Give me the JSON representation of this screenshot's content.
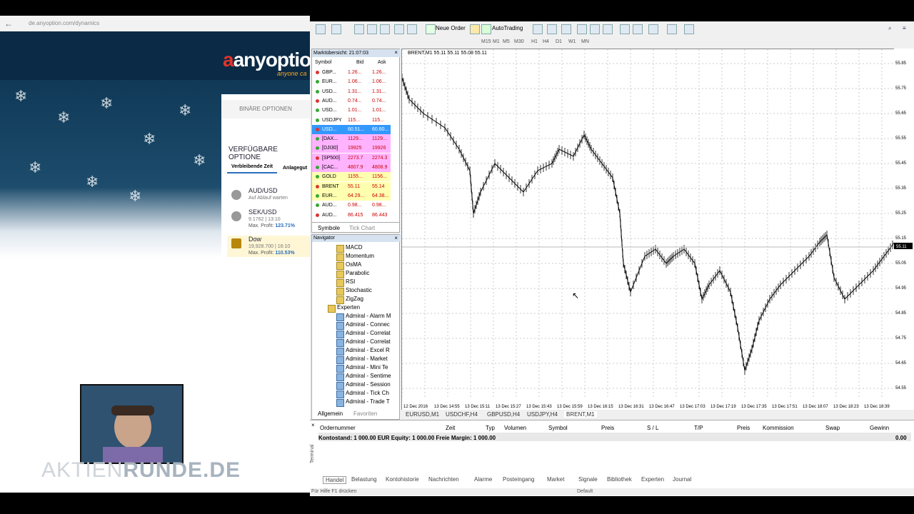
{
  "browser": {
    "url": "de.anyoption.com/dynamics",
    "logo": "anyoptio",
    "tagline": "anyone ca",
    "binaere_label": "BINÄRE OPTIONEN",
    "verfuegbare_label": "VERFÜGBARE OPTIONE",
    "tab_verbleibende": "Verbleibende Zeit",
    "tab_anlage": "Anlagegut",
    "assets": [
      {
        "name": "AUD/USD",
        "sub": "Auf Ablauf warten",
        "profit_label": "",
        "profit": ""
      },
      {
        "name": "SEK/USD",
        "sub": "9.1762 | 13:10",
        "profit_label": "Max. Profit:",
        "profit": "123.71%"
      },
      {
        "name": "Dow",
        "sub": "19,928.700 | 16:10",
        "profit_label": "Max. Profit:",
        "profit": "110.53%"
      }
    ],
    "watermark_left": "AKTIEN",
    "watermark_right": "RUNDE.DE"
  },
  "toolbar": {
    "new_order": "Neue Order",
    "autotrading": "AutoTrading",
    "timeframes": [
      "M1",
      "M5",
      "M15",
      "M30",
      "H1",
      "H4",
      "D1",
      "W1",
      "MN"
    ]
  },
  "market_watch": {
    "title": "Marktübersicht: 21:07:03",
    "col_symbol": "Symbol",
    "col_bid": "Bid",
    "col_ask": "Ask",
    "rows": [
      {
        "symbol": "GBP...",
        "bid": "1.26...",
        "ask": "1.26..."
      },
      {
        "symbol": "EUR...",
        "bid": "1.06...",
        "ask": "1.06..."
      },
      {
        "symbol": "USD...",
        "bid": "1.31...",
        "ask": "1.31..."
      },
      {
        "symbol": "AUD...",
        "bid": "0.74...",
        "ask": "0.74..."
      },
      {
        "symbol": "USD...",
        "bid": "1.01...",
        "ask": "1.01..."
      },
      {
        "symbol": "USDJPY",
        "bid": "115...",
        "ask": "115..."
      },
      {
        "symbol": "USD...",
        "bid": "60.51...",
        "ask": "60.60..."
      },
      {
        "symbol": "[DAX...",
        "bid": "1129...",
        "ask": "1129..."
      },
      {
        "symbol": "[DJI30]",
        "bid": "19925",
        "ask": "19926"
      },
      {
        "symbol": "[SP500]",
        "bid": "2273.7",
        "ask": "2274.3"
      },
      {
        "symbol": "[CAC...",
        "bid": "4807.9",
        "ask": "4808.9"
      },
      {
        "symbol": "GOLD",
        "bid": "1155...",
        "ask": "1156..."
      },
      {
        "symbol": "BRENT",
        "bid": "55.11",
        "ask": "55.14"
      },
      {
        "symbol": "EUR...",
        "bid": "64.29...",
        "ask": "64.38..."
      },
      {
        "symbol": "AUD...",
        "bid": "0.98...",
        "ask": "0.98..."
      },
      {
        "symbol": "AUD...",
        "bid": "86.415",
        "ask": "86.443"
      }
    ],
    "tab_symbole": "Symbole",
    "tab_tick": "Tick Chart"
  },
  "navigator": {
    "title": "Navigator",
    "items": [
      "MACD",
      "Momentum",
      "OsMA",
      "Parabolic",
      "RSI",
      "Stochastic",
      "ZigZag",
      "Experten",
      "Admiral - Alarm M",
      "Admiral - Connec",
      "Admiral - Correlat",
      "Admiral - Correlat",
      "Admiral - Excel R",
      "Admiral - Market",
      "Admiral - Mini Te",
      "Admiral - Sentime",
      "Admiral - Session",
      "Admiral - Tick Ch",
      "Admiral - Trade T"
    ],
    "tab_allgemein": "Allgemein",
    "tab_favoriten": "Favoriten"
  },
  "chart": {
    "header": "BRENT,M1  55.11 55.11 55.08 55.11",
    "price_tag": "55.11",
    "y_ticks": [
      "55.85",
      "55.75",
      "55.65",
      "55.55",
      "55.45",
      "55.35",
      "55.25",
      "55.15",
      "55.05",
      "54.95",
      "54.85",
      "54.75",
      "54.65",
      "54.55"
    ],
    "x_ticks": [
      "12 Dec 2016",
      "13 Dec 14:55",
      "13 Dec 15:11",
      "13 Dec 15:27",
      "13 Dec 15:43",
      "13 Dec 15:59",
      "13 Dec 16:15",
      "13 Dec 16:31",
      "13 Dec 16:47",
      "13 Dec 17:03",
      "13 Dec 17:19",
      "13 Dec 17:35",
      "13 Dec 17:51",
      "13 Dec 18:07",
      "13 Dec 18:23",
      "13 Dec 18:39"
    ],
    "tabs": [
      "EURUSD,M1",
      "USDCHF,H4",
      "GBPUSD,H4",
      "USDJPY,H4",
      "BRENT,M1"
    ]
  },
  "terminal": {
    "headers": [
      "Ordernummer",
      "Zeit",
      "Typ",
      "Volumen",
      "Symbol",
      "Preis",
      "S / L",
      "T/P",
      "Preis",
      "Kommission",
      "Swap",
      "Gewinn"
    ],
    "balance": "Kontostand: 1 000.00 EUR  Equity: 1 000.00  Freie Margin: 1 000.00",
    "profit": "0.00",
    "tabs": [
      "Handel",
      "Belastung",
      "Kontohistorie",
      "Nachrichten",
      "Alarme",
      "Posteingang",
      "Market",
      "Signale",
      "Bibliothek",
      "Experten",
      "Journal"
    ],
    "side_label": "Terminal"
  },
  "status": {
    "help": "Für Hilfe F1 drücken",
    "profile": "Default"
  }
}
